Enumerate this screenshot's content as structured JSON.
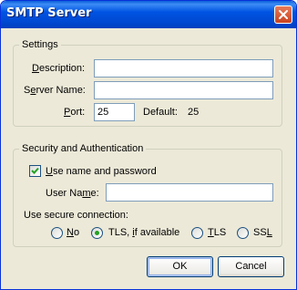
{
  "window": {
    "title": "SMTP Server"
  },
  "settings": {
    "legend": "Settings",
    "description_label_u": "D",
    "description_label_rest": "escription:",
    "description_value": "",
    "server_name_label_pre": "S",
    "server_name_label_u": "e",
    "server_name_label_rest": "rver Name:",
    "server_name_value": "",
    "port_label_u": "P",
    "port_label_rest": "ort:",
    "port_value": "25",
    "default_label": "Default:",
    "default_value": "25"
  },
  "security": {
    "legend": "Security and Authentication",
    "use_name_checked": true,
    "use_name_label_u": "U",
    "use_name_label_rest": "se name and password",
    "user_name_label_pre": "User Na",
    "user_name_label_u": "m",
    "user_name_label_rest": "e:",
    "user_name_value": "",
    "secure_connection_label": "Use secure connection:",
    "options": [
      {
        "label_u": "N",
        "label_rest": "o",
        "selected": false
      },
      {
        "label_pre": "TLS, ",
        "label_u": "i",
        "label_rest": "f available",
        "selected": true
      },
      {
        "label_u": "T",
        "label_rest": "LS",
        "selected": false
      },
      {
        "label_pre": "SS",
        "label_u": "L",
        "label_rest": "",
        "selected": false
      }
    ]
  },
  "buttons": {
    "ok": "OK",
    "cancel": "Cancel"
  },
  "icons": {
    "close": "close-icon",
    "check": "checkmark-icon"
  },
  "colors": {
    "titlebar": "#0054e3",
    "dialog_bg": "#ece9d8",
    "check": "#21a121"
  }
}
